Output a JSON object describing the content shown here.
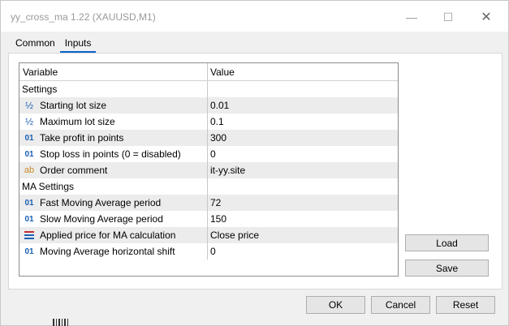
{
  "window": {
    "title": "yy_cross_ma 1.22 (XAUUSD,M1)",
    "controls": {
      "minimize": "—",
      "maximize": "☐",
      "close": "✕"
    }
  },
  "tabs": [
    {
      "label": "Common",
      "active": false
    },
    {
      "label": "Inputs",
      "active": true
    }
  ],
  "grid": {
    "columns": {
      "variable": "Variable",
      "value": "Value"
    },
    "rows": [
      {
        "type": "section",
        "variable": "Settings",
        "value": ""
      },
      {
        "type": "param",
        "icon": "fraction-icon",
        "icon_text": "½",
        "variable": "Starting lot size",
        "value": "0.01"
      },
      {
        "type": "param",
        "icon": "fraction-icon",
        "icon_text": "½",
        "variable": "Maximum lot size",
        "value": "0.1"
      },
      {
        "type": "param",
        "icon": "integer-icon",
        "icon_text": "01",
        "variable": "Take profit in points",
        "value": "300"
      },
      {
        "type": "param",
        "icon": "integer-icon",
        "icon_text": "01",
        "variable": "Stop loss in points (0 = disabled)",
        "value": "0"
      },
      {
        "type": "param",
        "icon": "string-icon",
        "icon_text": "ab",
        "variable": "Order comment",
        "value": "it-yy.site"
      },
      {
        "type": "section",
        "variable": "MA Settings",
        "value": ""
      },
      {
        "type": "param",
        "icon": "integer-icon",
        "icon_text": "01",
        "variable": "Fast Moving Average period",
        "value": "72"
      },
      {
        "type": "param",
        "icon": "integer-icon",
        "icon_text": "01",
        "variable": "Slow Moving Average period",
        "value": "150"
      },
      {
        "type": "param",
        "icon": "enum-icon",
        "icon_text": "",
        "variable": "Applied price for MA calculation",
        "value": "Close price"
      },
      {
        "type": "param",
        "icon": "integer-icon",
        "icon_text": "01",
        "variable": "Moving Average horizontal shift",
        "value": "0"
      }
    ]
  },
  "side_buttons": {
    "load": "Load",
    "save": "Save"
  },
  "bottom_buttons": {
    "ok": "OK",
    "cancel": "Cancel",
    "reset": "Reset"
  }
}
